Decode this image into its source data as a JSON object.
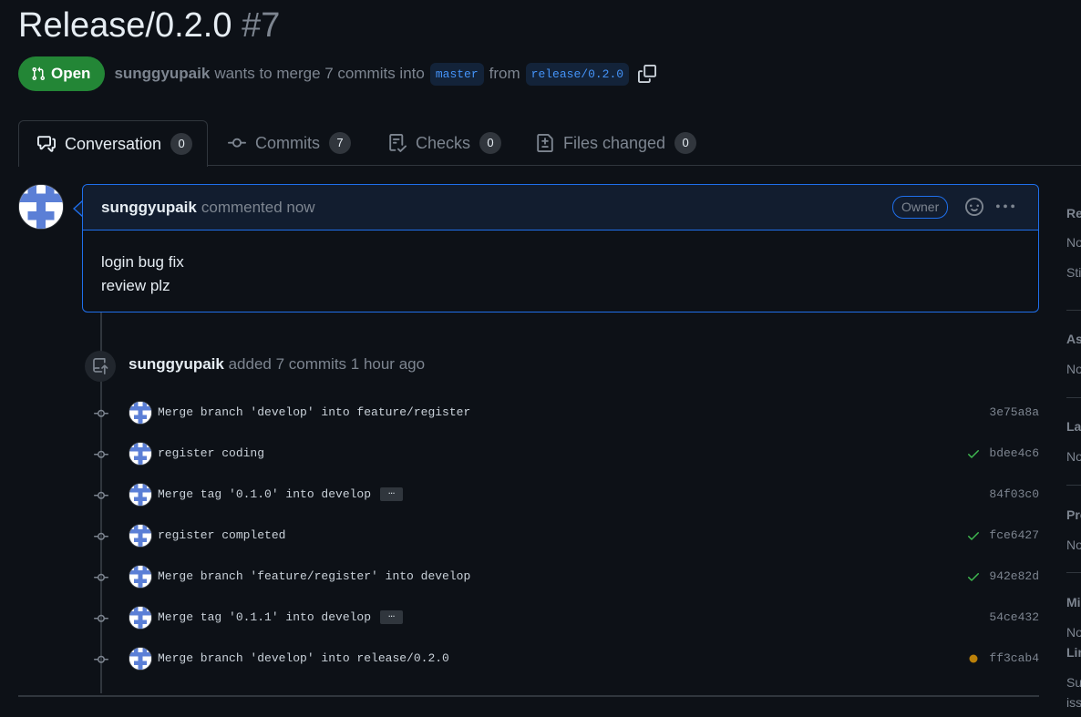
{
  "pr": {
    "title": "Release/0.2.0",
    "number": "#7",
    "state": "Open",
    "author": "sunggyupaik",
    "summary": "wants to merge 7 commits into",
    "base_branch": "master",
    "from_word": "from",
    "head_branch": "release/0.2.0"
  },
  "tabs": [
    {
      "label": "Conversation",
      "count": "0",
      "icon": "comment-discussion-icon"
    },
    {
      "label": "Commits",
      "count": "7",
      "icon": "git-commit-icon"
    },
    {
      "label": "Checks",
      "count": "0",
      "icon": "checklist-icon"
    },
    {
      "label": "Files changed",
      "count": "0",
      "icon": "file-diff-icon"
    }
  ],
  "comment": {
    "author": "sunggyupaik",
    "action": "commented now",
    "badge": "Owner",
    "body": [
      "login bug fix",
      "review plz"
    ]
  },
  "event": {
    "author": "sunggyupaik",
    "text": "added 7 commits 1 hour ago"
  },
  "commits": [
    {
      "message": "Merge branch 'develop' into feature/register",
      "sha": "3e75a8a",
      "status": "none",
      "expandable": false
    },
    {
      "message": "register coding",
      "sha": "bdee4c6",
      "status": "success",
      "expandable": false
    },
    {
      "message": "Merge tag '0.1.0' into develop",
      "sha": "84f03c0",
      "status": "none",
      "expandable": true
    },
    {
      "message": "register completed",
      "sha": "fce6427",
      "status": "success",
      "expandable": false
    },
    {
      "message": "Merge branch 'feature/register' into develop",
      "sha": "942e82d",
      "status": "success",
      "expandable": false
    },
    {
      "message": "Merge tag '0.1.1' into develop",
      "sha": "54ce432",
      "status": "none",
      "expandable": true
    },
    {
      "message": "Merge branch 'develop' into release/0.2.0",
      "sha": "ff3cab4",
      "status": "pending",
      "expandable": false
    }
  ],
  "sidebar": {
    "sections": [
      {
        "heading": "Re",
        "lines": [
          "No",
          "Sti"
        ]
      },
      {
        "heading": "As",
        "lines": [
          "No"
        ]
      },
      {
        "heading": "La",
        "lines": [
          "No"
        ]
      },
      {
        "heading": "Pro",
        "lines": [
          "No"
        ]
      },
      {
        "heading": "Mi",
        "lines": [
          "No"
        ]
      },
      {
        "heading": "Lin",
        "lines": [
          "Su",
          "iss"
        ]
      }
    ]
  },
  "colors": {
    "background": "#0d1117",
    "open_green": "#238636",
    "accent_blue": "#1f6feb",
    "success": "#3fb950",
    "pending": "#bb8009"
  }
}
